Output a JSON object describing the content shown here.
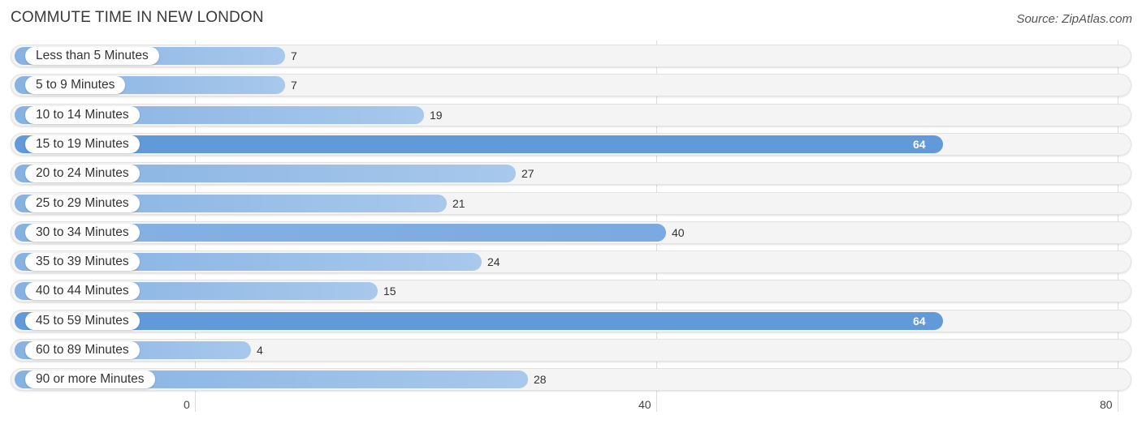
{
  "header": {
    "title": "COMMUTE TIME IN NEW LONDON",
    "source": "Source: ZipAtlas.com"
  },
  "colors": {
    "bar_light": "#a8c8ec",
    "bar_mid": "#86b2e2",
    "bar_highlight": "#6199d9",
    "track": "#f4f4f4"
  },
  "chart_data": {
    "type": "bar",
    "orientation": "horizontal",
    "title": "COMMUTE TIME IN NEW LONDON",
    "xlabel": "",
    "ylabel": "",
    "xlim": [
      0,
      80
    ],
    "xticks": [
      0,
      40,
      80
    ],
    "grid": true,
    "categories": [
      "Less than 5 Minutes",
      "5 to 9 Minutes",
      "10 to 14 Minutes",
      "15 to 19 Minutes",
      "20 to 24 Minutes",
      "25 to 29 Minutes",
      "30 to 34 Minutes",
      "35 to 39 Minutes",
      "40 to 44 Minutes",
      "45 to 59 Minutes",
      "60 to 89 Minutes",
      "90 or more Minutes"
    ],
    "values": [
      7,
      7,
      19,
      64,
      27,
      21,
      40,
      24,
      15,
      64,
      4,
      28
    ]
  }
}
